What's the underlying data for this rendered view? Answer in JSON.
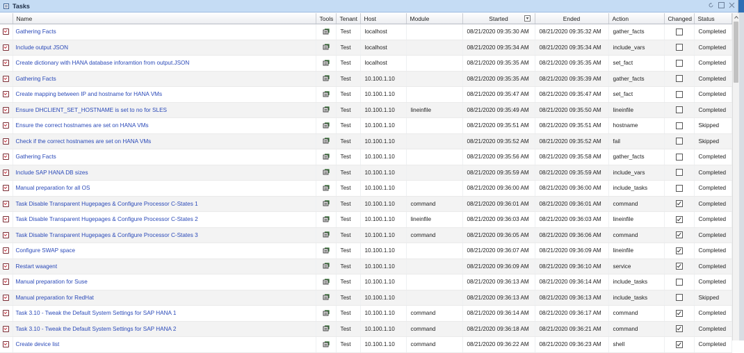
{
  "window": {
    "title": "Tasks",
    "controls": [
      "refresh-icon",
      "maximize-icon",
      "close-icon"
    ]
  },
  "colors": {
    "titlebar": "#c5dcf4",
    "link": "#2a49b8",
    "row_alt": "#f3f3f3"
  },
  "columns": [
    "",
    "Name",
    "Tools",
    "Tenant",
    "Host",
    "Module",
    "Started",
    "Ended",
    "Action",
    "Changed",
    "Status"
  ],
  "rows": [
    {
      "name": "Gathering Facts",
      "tenant": "Test",
      "host": "localhost",
      "module": "",
      "started": "08/21/2020 09:35:30 AM",
      "ended": "08/21/2020 09:35:32 AM",
      "action": "gather_facts",
      "changed": false,
      "status": "Completed"
    },
    {
      "name": "Include output JSON",
      "tenant": "Test",
      "host": "localhost",
      "module": "",
      "started": "08/21/2020 09:35:34 AM",
      "ended": "08/21/2020 09:35:34 AM",
      "action": "include_vars",
      "changed": false,
      "status": "Completed"
    },
    {
      "name": "Create dictionary with HANA database inforamtion from output.JSON",
      "tenant": "Test",
      "host": "localhost",
      "module": "",
      "started": "08/21/2020 09:35:35 AM",
      "ended": "08/21/2020 09:35:35 AM",
      "action": "set_fact",
      "changed": false,
      "status": "Completed"
    },
    {
      "name": "Gathering Facts",
      "tenant": "Test",
      "host": "10.100.1.10",
      "module": "",
      "started": "08/21/2020 09:35:35 AM",
      "ended": "08/21/2020 09:35:39 AM",
      "action": "gather_facts",
      "changed": false,
      "status": "Completed"
    },
    {
      "name": "Create mapping between IP and hostname for HANA VMs",
      "tenant": "Test",
      "host": "10.100.1.10",
      "module": "",
      "started": "08/21/2020 09:35:47 AM",
      "ended": "08/21/2020 09:35:47 AM",
      "action": "set_fact",
      "changed": false,
      "status": "Completed"
    },
    {
      "name": "Ensure DHCLIENT_SET_HOSTNAME is set to no for SLES",
      "tenant": "Test",
      "host": "10.100.1.10",
      "module": "lineinfile",
      "started": "08/21/2020 09:35:49 AM",
      "ended": "08/21/2020 09:35:50 AM",
      "action": "lineinfile",
      "changed": false,
      "status": "Completed"
    },
    {
      "name": "Ensure the correct hostnames are set on HANA VMs",
      "tenant": "Test",
      "host": "10.100.1.10",
      "module": "",
      "started": "08/21/2020 09:35:51 AM",
      "ended": "08/21/2020 09:35:51 AM",
      "action": "hostname",
      "changed": false,
      "status": "Skipped"
    },
    {
      "name": "Check if the correct hostnames are set on HANA VMs",
      "tenant": "Test",
      "host": "10.100.1.10",
      "module": "",
      "started": "08/21/2020 09:35:52 AM",
      "ended": "08/21/2020 09:35:52 AM",
      "action": "fail",
      "changed": false,
      "status": "Skipped"
    },
    {
      "name": "Gathering Facts",
      "tenant": "Test",
      "host": "10.100.1.10",
      "module": "",
      "started": "08/21/2020 09:35:56 AM",
      "ended": "08/21/2020 09:35:58 AM",
      "action": "gather_facts",
      "changed": false,
      "status": "Completed"
    },
    {
      "name": "Include SAP HANA DB sizes",
      "tenant": "Test",
      "host": "10.100.1.10",
      "module": "",
      "started": "08/21/2020 09:35:59 AM",
      "ended": "08/21/2020 09:35:59 AM",
      "action": "include_vars",
      "changed": false,
      "status": "Completed"
    },
    {
      "name": "Manual preparation for all OS",
      "tenant": "Test",
      "host": "10.100.1.10",
      "module": "",
      "started": "08/21/2020 09:36:00 AM",
      "ended": "08/21/2020 09:36:00 AM",
      "action": "include_tasks",
      "changed": false,
      "status": "Completed"
    },
    {
      "name": "Task Disable Transparent Hugepages & Configure Processor C-States 1",
      "tenant": "Test",
      "host": "10.100.1.10",
      "module": "command",
      "started": "08/21/2020 09:36:01 AM",
      "ended": "08/21/2020 09:36:01 AM",
      "action": "command",
      "changed": true,
      "status": "Completed"
    },
    {
      "name": "Task Disable Transparent Hugepages & Configure Processor C-States 2",
      "tenant": "Test",
      "host": "10.100.1.10",
      "module": "lineinfile",
      "started": "08/21/2020 09:36:03 AM",
      "ended": "08/21/2020 09:36:03 AM",
      "action": "lineinfile",
      "changed": true,
      "status": "Completed"
    },
    {
      "name": "Task Disable Transparent Hugepages & Configure Processor C-States 3",
      "tenant": "Test",
      "host": "10.100.1.10",
      "module": "command",
      "started": "08/21/2020 09:36:05 AM",
      "ended": "08/21/2020 09:36:06 AM",
      "action": "command",
      "changed": true,
      "status": "Completed"
    },
    {
      "name": "Configure SWAP space",
      "tenant": "Test",
      "host": "10.100.1.10",
      "module": "",
      "started": "08/21/2020 09:36:07 AM",
      "ended": "08/21/2020 09:36:09 AM",
      "action": "lineinfile",
      "changed": true,
      "status": "Completed"
    },
    {
      "name": "Restart waagent",
      "tenant": "Test",
      "host": "10.100.1.10",
      "module": "",
      "started": "08/21/2020 09:36:09 AM",
      "ended": "08/21/2020 09:36:10 AM",
      "action": "service",
      "changed": true,
      "status": "Completed"
    },
    {
      "name": "Manual preparation for Suse",
      "tenant": "Test",
      "host": "10.100.1.10",
      "module": "",
      "started": "08/21/2020 09:36:13 AM",
      "ended": "08/21/2020 09:36:14 AM",
      "action": "include_tasks",
      "changed": false,
      "status": "Completed"
    },
    {
      "name": "Manual preparation for RedHat",
      "tenant": "Test",
      "host": "10.100.1.10",
      "module": "",
      "started": "08/21/2020 09:36:13 AM",
      "ended": "08/21/2020 09:36:13 AM",
      "action": "include_tasks",
      "changed": false,
      "status": "Skipped"
    },
    {
      "name": "Task 3.10 - Tweak the Default System Settings for SAP HANA 1",
      "tenant": "Test",
      "host": "10.100.1.10",
      "module": "command",
      "started": "08/21/2020 09:36:14 AM",
      "ended": "08/21/2020 09:36:17 AM",
      "action": "command",
      "changed": true,
      "status": "Completed"
    },
    {
      "name": "Task 3.10 - Tweak the Default System Settings for SAP HANA 2",
      "tenant": "Test",
      "host": "10.100.1.10",
      "module": "command",
      "started": "08/21/2020 09:36:18 AM",
      "ended": "08/21/2020 09:36:21 AM",
      "action": "command",
      "changed": true,
      "status": "Completed"
    },
    {
      "name": "Create device list",
      "tenant": "Test",
      "host": "10.100.1.10",
      "module": "command",
      "started": "08/21/2020 09:36:22 AM",
      "ended": "08/21/2020 09:36:23 AM",
      "action": "shell",
      "changed": true,
      "status": "Completed"
    }
  ]
}
